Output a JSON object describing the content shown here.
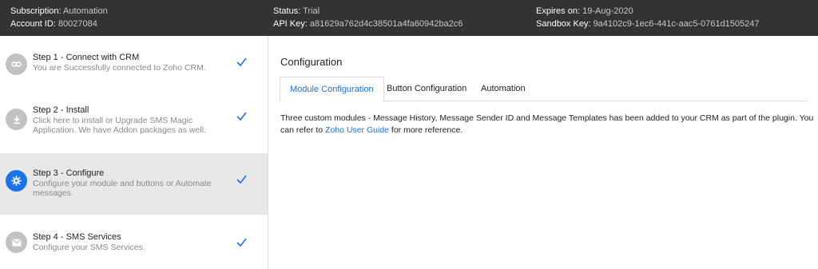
{
  "header": {
    "subscription_label": "Subscription:",
    "subscription_value": "Automation",
    "account_label": "Account ID:",
    "account_value": "80027084",
    "status_label": "Status:",
    "status_value": "Trial",
    "api_key_label": "API Key:",
    "api_key_value": "a81629a762d4c38501a4fa60942ba2c6",
    "expires_label": "Expires on:",
    "expires_value": "19-Aug-2020",
    "sandbox_label": "Sandbox Key:",
    "sandbox_value": "9a4102c9-1ec6-441c-aac5-0761d1505247"
  },
  "sidebar": {
    "steps": [
      {
        "title": "Step 1 - Connect with CRM",
        "desc": "You are Successfully connected to Zoho CRM.",
        "icon": "link-icon",
        "done": true
      },
      {
        "title": "Step 2 - Install",
        "desc": "Click here to install or Upgrade SMS Magic Application. We have Addon packages as well.",
        "icon": "download-icon",
        "done": true
      },
      {
        "title": "Step 3 - Configure",
        "desc": "Configure your module and buttons or Automate messages.",
        "icon": "gear-icon",
        "done": true,
        "active": true
      },
      {
        "title": "Step 4 - SMS Services",
        "desc": "Configure your SMS Services.",
        "icon": "envelope-icon",
        "done": true
      }
    ]
  },
  "main": {
    "section_title": "Configuration",
    "tabs": [
      {
        "label": "Module Configuration",
        "active": true
      },
      {
        "label": "Button Configuration",
        "active": false
      },
      {
        "label": "Automation",
        "active": false
      }
    ],
    "content_text_before": "Three custom modules - Message History, Message Sender ID and Message Templates has been added to your CRM as part of the plugin. You can refer to ",
    "content_link": "Zoho User Guide",
    "content_text_after": " for more reference."
  },
  "colors": {
    "header_bg": "#333333",
    "accent": "#1a73e8",
    "active_step_bg": "#e8e8e8",
    "inactive_icon_bg": "#c2c2c2"
  }
}
